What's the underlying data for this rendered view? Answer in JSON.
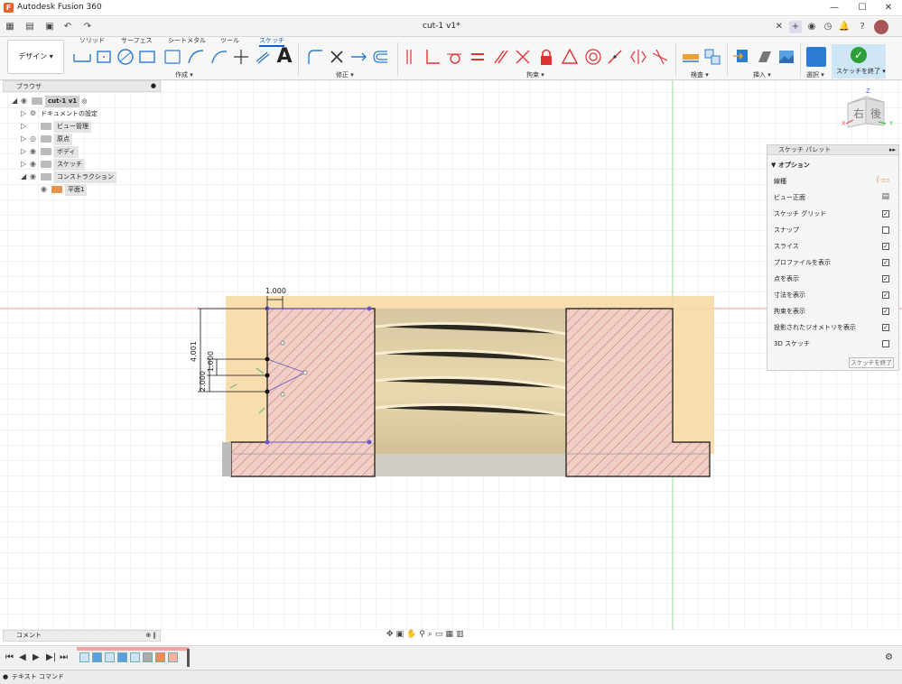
{
  "window": {
    "app_title": "Autodesk Fusion 360",
    "minimize": "—",
    "maximize": "☐",
    "close": "✕"
  },
  "quickbar": {
    "doc_title": "cut-1 v1*"
  },
  "ribbon": {
    "design_label": "デザイン ▾",
    "tabs": [
      "ソリッド",
      "サーフェス",
      "シートメタル",
      "ツール",
      "スケッチ"
    ],
    "active_tab": "スケッチ",
    "groups": {
      "create": "作成 ▾",
      "modify": "修正 ▾",
      "constraints": "拘束 ▾",
      "inspect": "検査 ▾",
      "insert": "挿入 ▾",
      "select": "選択 ▾",
      "finish": "スケッチを終了 ▾"
    }
  },
  "browser": {
    "header": "ブラウザ",
    "items": [
      {
        "label": "cut-1 v1",
        "level": 0
      },
      {
        "label": "ドキュメントの設定",
        "level": 1
      },
      {
        "label": "ビュー管理",
        "level": 1
      },
      {
        "label": "原点",
        "level": 1
      },
      {
        "label": "ボディ",
        "level": 1
      },
      {
        "label": "スケッチ",
        "level": 1
      },
      {
        "label": "コンストラクション",
        "level": 1
      },
      {
        "label": "平面1",
        "level": 2
      }
    ]
  },
  "sketch_palette": {
    "header": "スケッチ パレット",
    "section": "オプション",
    "rows": [
      {
        "label": "線種",
        "type": "icon"
      },
      {
        "label": "ビュー正面",
        "type": "icon"
      },
      {
        "label": "スケッチ グリッド",
        "type": "check",
        "checked": true
      },
      {
        "label": "スナップ",
        "type": "check",
        "checked": false
      },
      {
        "label": "スライス",
        "type": "check",
        "checked": true
      },
      {
        "label": "プロファイルを表示",
        "type": "check",
        "checked": true
      },
      {
        "label": "点を表示",
        "type": "check",
        "checked": true
      },
      {
        "label": "寸法を表示",
        "type": "check",
        "checked": true
      },
      {
        "label": "拘束を表示",
        "type": "check",
        "checked": true
      },
      {
        "label": "投影されたジオメトリを表示",
        "type": "check",
        "checked": true
      },
      {
        "label": "3D スケッチ",
        "type": "check",
        "checked": false
      }
    ],
    "finish_button": "スケッチを終了"
  },
  "viewcube": {
    "face_right": "右",
    "face_back": "後",
    "axis_x": "X",
    "axis_y": "Y",
    "axis_z": "Z"
  },
  "dimensions": {
    "top": "1.000",
    "left_big": "4.001",
    "mid": "1.000",
    "left_small": "2.000"
  },
  "comment_panel": {
    "label": "コメント"
  },
  "status_bar": {
    "text": "テキスト コマンド"
  },
  "colors": {
    "accent": "#0a63c9",
    "profile_fill": "#f7d9a6",
    "hatch_fill": "#f1cfc6",
    "finish_green": "#2e9e36"
  }
}
